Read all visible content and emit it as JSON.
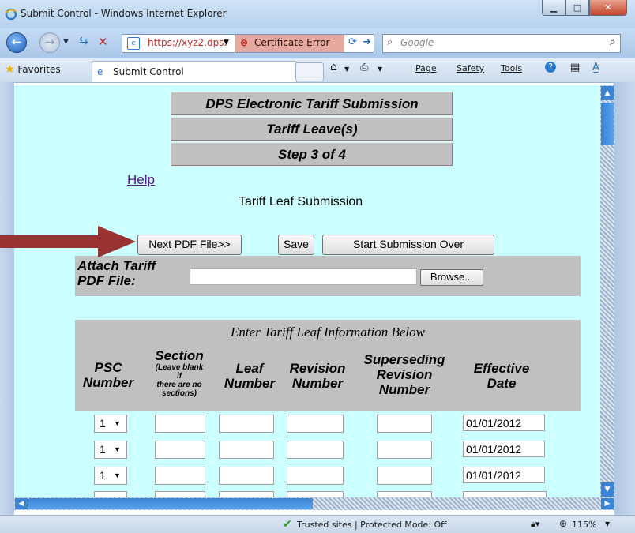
{
  "window": {
    "title": "Submit Control - Windows Internet Explorer"
  },
  "address_bar": {
    "url": "https://xyz2.dps.",
    "cert_error": "Certificate Error"
  },
  "search": {
    "placeholder": "Google"
  },
  "command_bar": {
    "favorites": "Favorites",
    "tab_title": "Submit Control",
    "menus": [
      "Page",
      "Safety",
      "Tools"
    ]
  },
  "page": {
    "header_lines": [
      "DPS Electronic Tariff Submission",
      "Tariff Leave(s)",
      "Step 3 of 4"
    ],
    "help_link": "Help",
    "subtitle": "Tariff Leaf Submission",
    "buttons": {
      "next_pdf": "Next PDF File>>",
      "save": "Save",
      "start_over": "Start Submission Over"
    },
    "attach": {
      "label_line1": "Attach Tariff",
      "label_line2": "PDF File:",
      "browse": "Browse..."
    },
    "leaf_section": {
      "caption": "Enter Tariff Leaf Information Below",
      "columns": {
        "psc": [
          "PSC",
          "Number"
        ],
        "section": "Section",
        "section_note": [
          "(Leave blank",
          "if",
          "there are no",
          "sections)"
        ],
        "leaf": [
          "Leaf",
          "Number"
        ],
        "revision": [
          "Revision",
          "Number"
        ],
        "superseding": [
          "Superseding",
          "Revision",
          "Number"
        ],
        "effective": [
          "Effective",
          "Date"
        ]
      },
      "rows": [
        {
          "psc": "1",
          "effective_date": "01/01/2012"
        },
        {
          "psc": "1",
          "effective_date": "01/01/2012"
        },
        {
          "psc": "1",
          "effective_date": "01/01/2012"
        }
      ]
    }
  },
  "status_bar": {
    "zone": "Trusted sites | Protected Mode: Off",
    "zoom": "115%"
  },
  "colors": {
    "page_bg": "#ccffff",
    "panel": "#c0c0c0",
    "arrow": "#993333",
    "link": "#551a8b"
  }
}
